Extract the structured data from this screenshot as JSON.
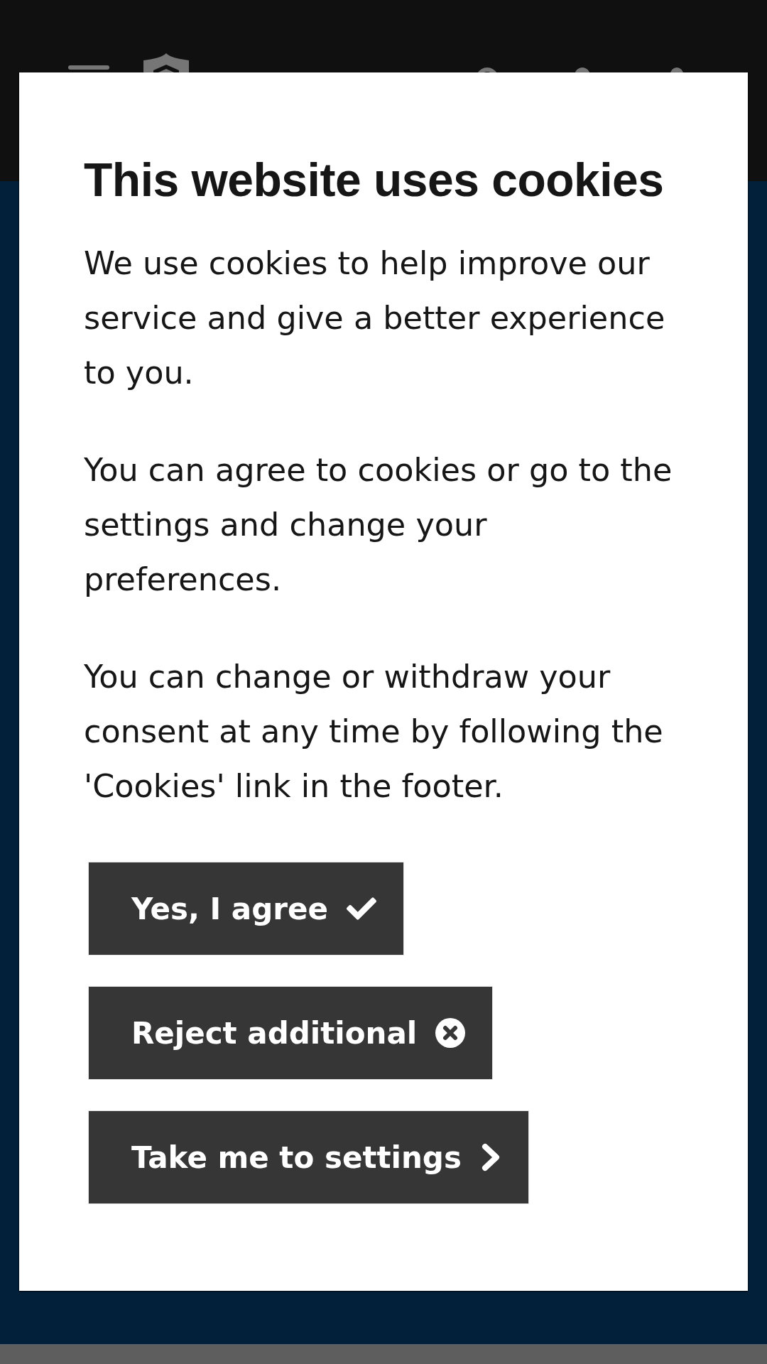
{
  "dialog": {
    "title": "This website uses cookies",
    "paragraphs": [
      "We use cookies to help improve our service and give a better experience to you.",
      "You can agree to cookies or go to the settings and change your preferences.",
      "You can change or withdraw your consent at any time by following the 'Cookies' link in the footer."
    ],
    "buttons": [
      {
        "label": "Yes, I agree",
        "kind": "accept"
      },
      {
        "label": "Reject additional",
        "kind": "reject"
      },
      {
        "label": "Take me to settings",
        "kind": "settings"
      }
    ]
  }
}
